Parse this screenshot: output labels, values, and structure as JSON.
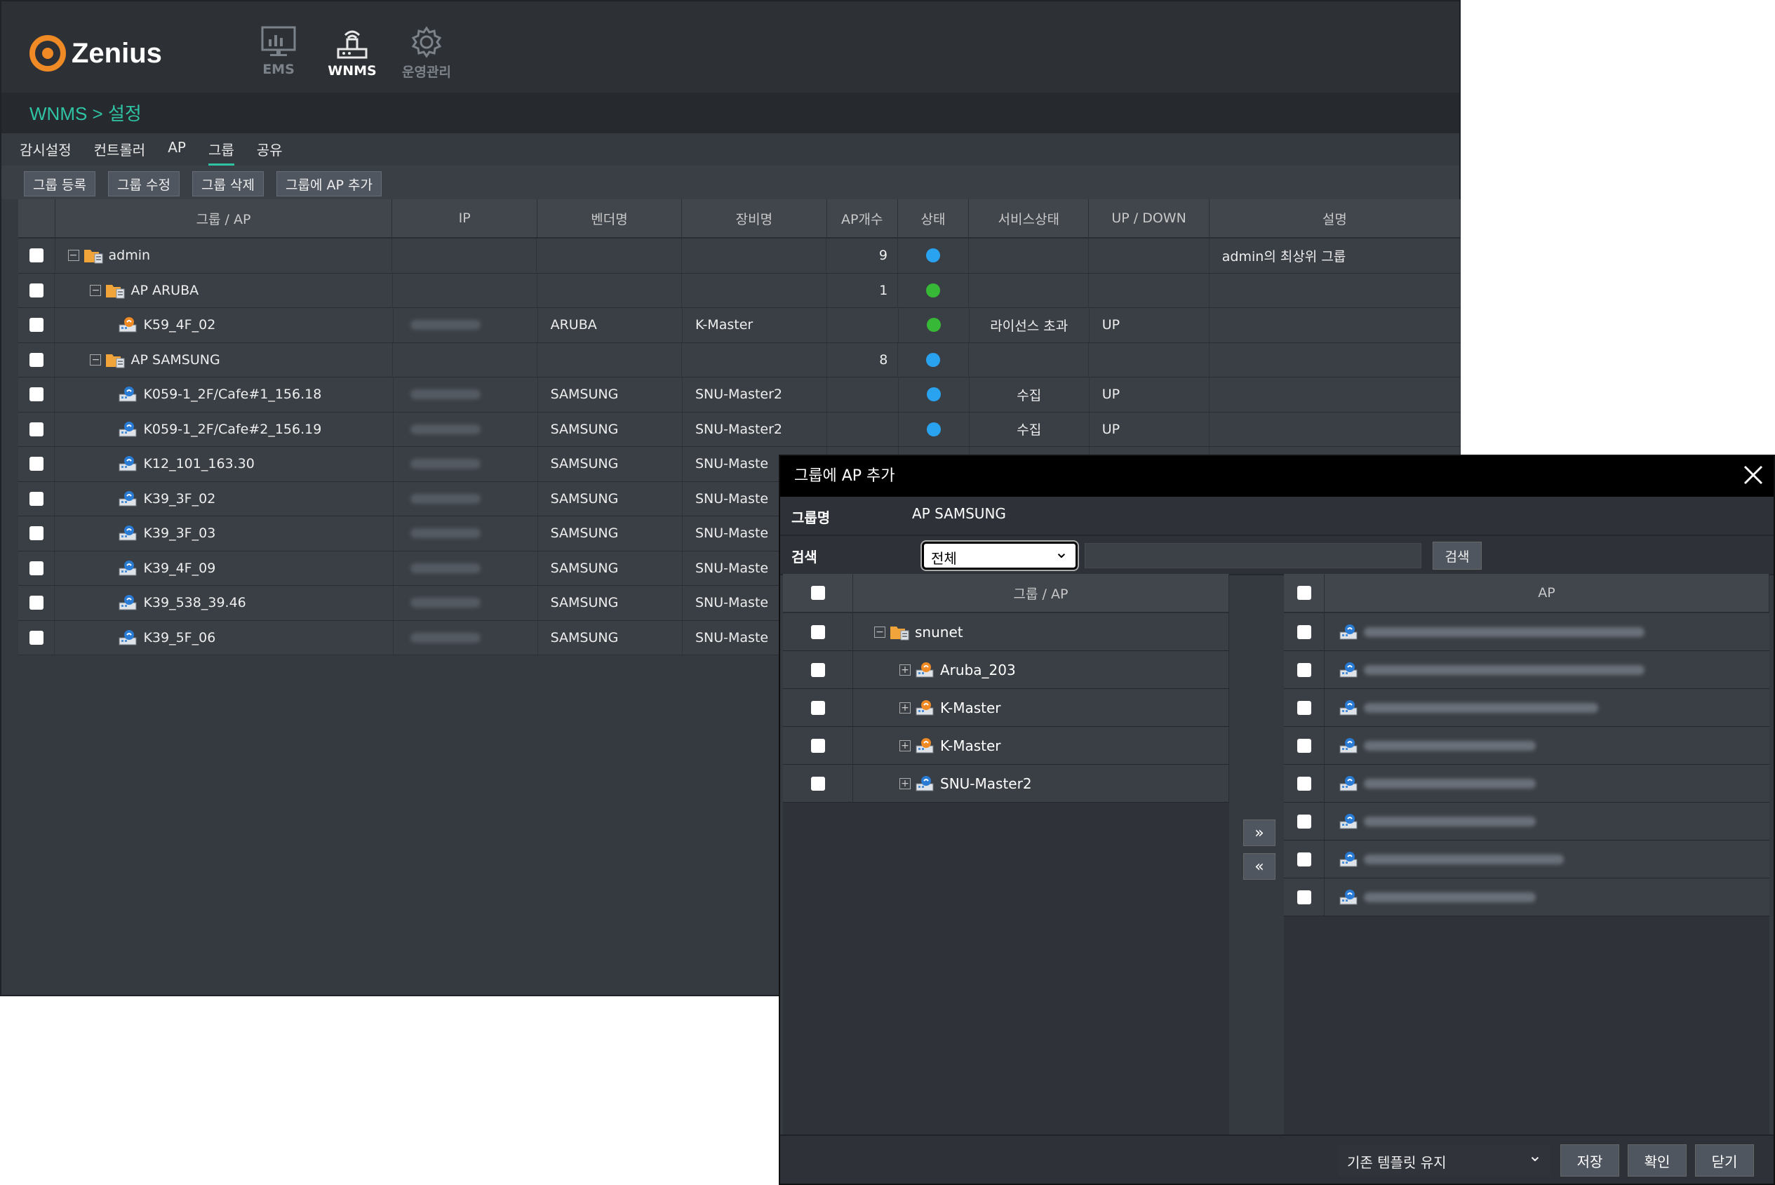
{
  "app": {
    "brand": "Zenius"
  },
  "nav": [
    {
      "label": "EMS",
      "icon": "monitor-icon",
      "active": false
    },
    {
      "label": "WNMS",
      "icon": "wireless-router-icon",
      "active": true
    },
    {
      "label": "운영관리",
      "icon": "gear-icon",
      "active": false
    }
  ],
  "breadcrumb": "WNMS > 설정",
  "tabs": [
    "감시설정",
    "컨트롤러",
    "AP",
    "그룹",
    "공유"
  ],
  "toolbar": [
    "그룹 등록",
    "그룹 수정",
    "그룹 삭제",
    "그룹에 AP 추가"
  ],
  "grid": {
    "columns": [
      "그룹 / AP",
      "IP",
      "벤더명",
      "장비명",
      "AP개수",
      "상태",
      "서비스상태",
      "UP / DOWN",
      "설명"
    ],
    "rows": [
      {
        "level": 0,
        "type": "group",
        "name": "admin",
        "ip": "",
        "vendor": "",
        "device": "",
        "count": "9",
        "state": "#29a3ef",
        "svc": "",
        "updown": "",
        "desc": "admin의 최상위 그룹"
      },
      {
        "level": 1,
        "type": "group",
        "name": "AP ARUBA",
        "ip": "",
        "vendor": "",
        "device": "",
        "count": "1",
        "state": "#37b836",
        "svc": "",
        "updown": "",
        "desc": ""
      },
      {
        "level": 2,
        "type": "ap-orange",
        "name": "K59_4F_02",
        "ip": "blur",
        "vendor": "ARUBA",
        "device": "K-Master",
        "count": "",
        "state": "#37b836",
        "svc": "라이선스 초과",
        "updown": "UP",
        "desc": ""
      },
      {
        "level": 1,
        "type": "group",
        "name": "AP SAMSUNG",
        "ip": "",
        "vendor": "",
        "device": "",
        "count": "8",
        "state": "#29a3ef",
        "svc": "",
        "updown": "",
        "desc": ""
      },
      {
        "level": 2,
        "type": "ap-blue",
        "name": "K059-1_2F/Cafe#1_156.18",
        "ip": "blur",
        "vendor": "SAMSUNG",
        "device": "SNU-Master2",
        "count": "",
        "state": "#29a3ef",
        "svc": "수집",
        "updown": "UP",
        "desc": ""
      },
      {
        "level": 2,
        "type": "ap-blue",
        "name": "K059-1_2F/Cafe#2_156.19",
        "ip": "blur",
        "vendor": "SAMSUNG",
        "device": "SNU-Master2",
        "count": "",
        "state": "#29a3ef",
        "svc": "수집",
        "updown": "UP",
        "desc": ""
      },
      {
        "level": 2,
        "type": "ap-blue",
        "name": "K12_101_163.30",
        "ip": "blur",
        "vendor": "SAMSUNG",
        "device": "SNU-Maste",
        "count": "",
        "state": "",
        "svc": "",
        "updown": "",
        "desc": ""
      },
      {
        "level": 2,
        "type": "ap-blue",
        "name": "K39_3F_02",
        "ip": "blur",
        "vendor": "SAMSUNG",
        "device": "SNU-Maste",
        "count": "",
        "state": "",
        "svc": "",
        "updown": "",
        "desc": ""
      },
      {
        "level": 2,
        "type": "ap-blue",
        "name": "K39_3F_03",
        "ip": "blur",
        "vendor": "SAMSUNG",
        "device": "SNU-Maste",
        "count": "",
        "state": "",
        "svc": "",
        "updown": "",
        "desc": ""
      },
      {
        "level": 2,
        "type": "ap-blue",
        "name": "K39_4F_09",
        "ip": "blur",
        "vendor": "SAMSUNG",
        "device": "SNU-Maste",
        "count": "",
        "state": "",
        "svc": "",
        "updown": "",
        "desc": ""
      },
      {
        "level": 2,
        "type": "ap-blue",
        "name": "K39_538_39.46",
        "ip": "blur",
        "vendor": "SAMSUNG",
        "device": "SNU-Maste",
        "count": "",
        "state": "",
        "svc": "",
        "updown": "",
        "desc": ""
      },
      {
        "level": 2,
        "type": "ap-blue",
        "name": "K39_5F_06",
        "ip": "blur",
        "vendor": "SAMSUNG",
        "device": "SNU-Maste",
        "count": "",
        "state": "",
        "svc": "",
        "updown": "",
        "desc": ""
      }
    ]
  },
  "dialog": {
    "title": "그룹에 AP 추가",
    "group_label": "그룹명",
    "group_value": "AP SAMSUNG",
    "search_label": "검색",
    "search_select": "전체",
    "search_button": "검색",
    "left_header": "그룹 / AP",
    "left_rows": [
      {
        "name": "snunet",
        "type": "group",
        "indent": 0,
        "toggle": "−"
      },
      {
        "name": "Aruba_203",
        "type": "ap-orange",
        "indent": 1,
        "toggle": "+"
      },
      {
        "name": "K-Master",
        "type": "ap-orange",
        "indent": 1,
        "toggle": "+"
      },
      {
        "name": "K-Master",
        "type": "ap-orange",
        "indent": 1,
        "toggle": "+"
      },
      {
        "name": "SNU-Master2",
        "type": "ap-blue",
        "indent": 1,
        "toggle": "+"
      }
    ],
    "move_right": "»",
    "move_left": "«",
    "right_header": "AP",
    "right_count": 8,
    "template_select": "기존 템플릿 유지",
    "save": "저장",
    "ok": "확인",
    "close": "닫기"
  },
  "colors": {
    "accent": "#2fc3a4",
    "status_blue": "#29a3ef",
    "status_green": "#37b836",
    "logo_orange": "#f08a24"
  }
}
